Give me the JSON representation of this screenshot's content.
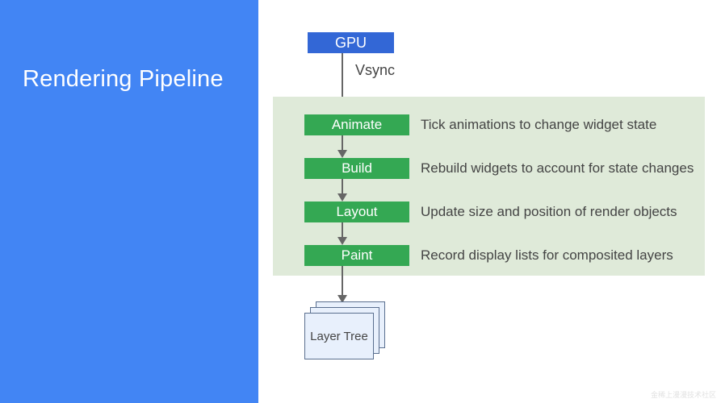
{
  "sidebar": {
    "title": "Rendering Pipeline"
  },
  "gpu": {
    "label": "GPU",
    "signal": "Vsync"
  },
  "stages": [
    {
      "name": "Animate",
      "desc": "Tick animations to change widget state"
    },
    {
      "name": "Build",
      "desc": "Rebuild widgets to account for state changes"
    },
    {
      "name": "Layout",
      "desc": "Update size and position of render objects"
    },
    {
      "name": "Paint",
      "desc": "Record display lists for composited layers"
    }
  ],
  "output": {
    "label": "Layer Tree"
  },
  "watermark": "金稀上漫漫技术社区"
}
